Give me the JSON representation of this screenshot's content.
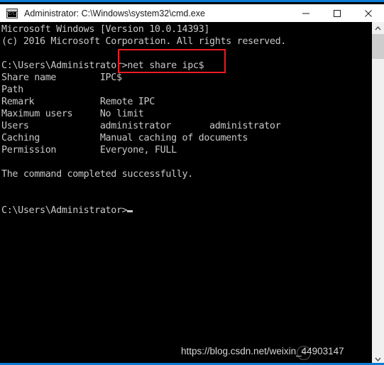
{
  "window": {
    "title": "Administrator: C:\\Windows\\system32\\cmd.exe",
    "icon_name": "cmd-console-icon",
    "icon_glyph": "C:\\.",
    "accent_color": "#0c7cd5",
    "controls": {
      "minimize_label": "Minimize",
      "maximize_label": "Maximize",
      "close_label": "Close"
    }
  },
  "console": {
    "background_color": "#000000",
    "text_color": "#c8c8c8",
    "content": "Microsoft Windows [Version 10.0.14393]\n(c) 2016 Microsoft Corporation. All rights reserved.\n\nC:\\Users\\Administrator>net share ipc$\nShare name        IPC$\nPath\nRemark            Remote IPC\nMaximum users     No limit\nUsers             administrator       administrator\nCaching           Manual caching of documents\nPermission        Everyone, FULL\n\nThe command completed successfully.\n\n\nC:\\Users\\Administrator>",
    "lines": [
      "Microsoft Windows [Version 10.0.14393]",
      "(c) 2016 Microsoft Corporation. All rights reserved.",
      "",
      "C:\\Users\\Administrator>net share ipc$",
      "Share name        IPC$",
      "Path",
      "Remark            Remote IPC",
      "Maximum users     No limit",
      "Users             administrator       administrator",
      "Caching           Manual caching of documents",
      "Permission        Everyone, FULL",
      "",
      "The command completed successfully.",
      "",
      "",
      "C:\\Users\\Administrator>"
    ],
    "command_entered": "net share ipc$",
    "prompt": "C:\\Users\\Administrator>",
    "share_details": {
      "share_name": "IPC$",
      "path": "",
      "remark": "Remote IPC",
      "maximum_users": "No limit",
      "users": "administrator       administrator",
      "caching": "Manual caching of documents",
      "permission": "Everyone, FULL"
    },
    "status_message": "The command completed successfully."
  },
  "annotation": {
    "color": "#e81c23",
    "highlights_text": "net share ipc$"
  },
  "watermark": {
    "text": "https://blog.csdn.net/weixin_44903147",
    "logo_glyph": "C"
  },
  "scrollbar": {
    "up_arrow": "˄",
    "down_arrow": "˅"
  }
}
